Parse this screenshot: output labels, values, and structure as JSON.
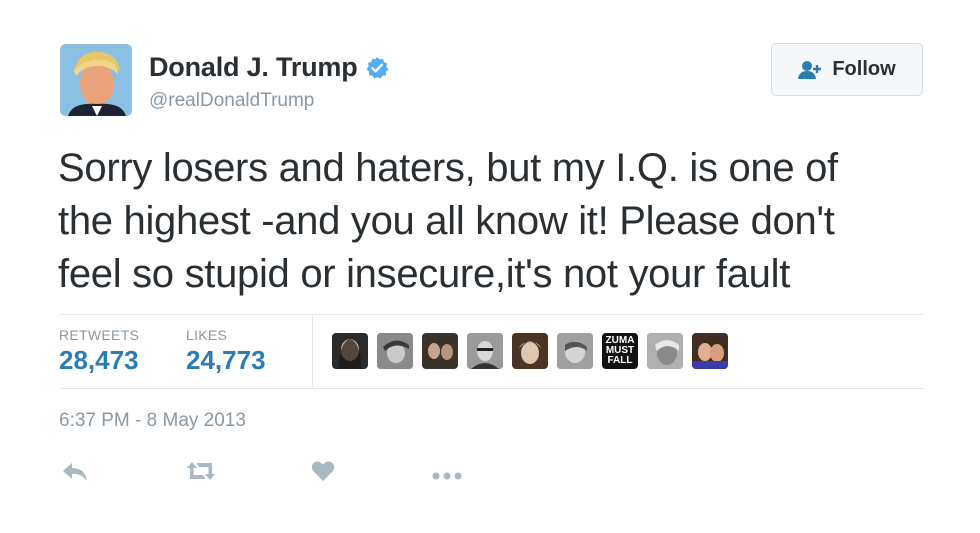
{
  "user": {
    "name": "Donald J. Trump",
    "handle": "@realDonaldTrump",
    "verified_icon": "verified-badge-icon"
  },
  "follow_button": {
    "label": "Follow",
    "icon": "add-user-icon"
  },
  "tweet": {
    "text_lines": [
      "Sorry losers and haters, but my I.Q. is one of",
      "the highest -and you all know it! Please don't",
      "feel so stupid or insecure,it's not your fault"
    ],
    "timestamp": "6:37 PM - 8 May 2013"
  },
  "stats": {
    "retweets_label": "RETWEETS",
    "retweets_value": "28,473",
    "likes_label": "LIKES",
    "likes_value": "24,773"
  },
  "likers": {
    "zuma_text": [
      "ZUMA",
      "MUST",
      "FALL"
    ]
  },
  "actions": [
    "reply-icon",
    "retweet-icon",
    "like-heart-icon",
    "more-dots-icon"
  ],
  "colors": {
    "stat_value": "#2a7db3",
    "muted": "#8899a6",
    "verified": "#55acee",
    "action_icon": "#aab8c2"
  }
}
